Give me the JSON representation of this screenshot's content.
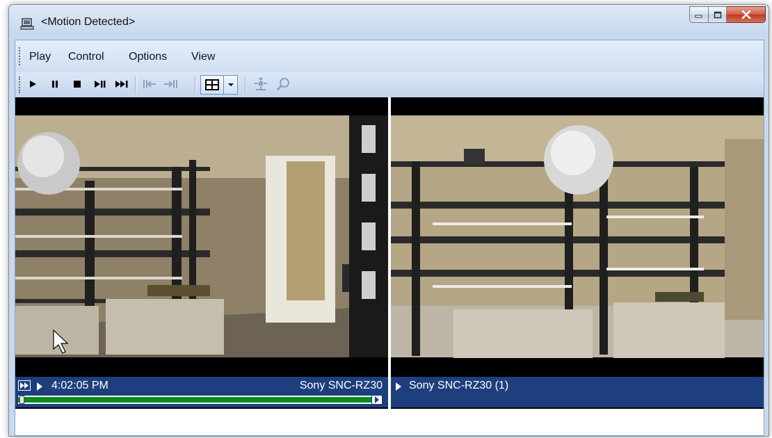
{
  "window": {
    "title": "<Motion Detected>",
    "app_icon": "computer-monitor-icon"
  },
  "caption_buttons": [
    "minimize-icon",
    "maximize-icon",
    "close-icon"
  ],
  "menu": {
    "items": [
      {
        "label": "Play"
      },
      {
        "label": "Control"
      },
      {
        "label": "Options"
      },
      {
        "label": "View"
      }
    ]
  },
  "toolbar": {
    "buttons": [
      "play-icon",
      "pause-icon",
      "stop-icon",
      "step-frame-icon",
      "skip-end-icon",
      "seek-back-icon",
      "seek-forward-icon",
      "layout-grid-icon",
      "dropdown-arrow-icon",
      "ptz-icon",
      "zoom-icon"
    ]
  },
  "panes": [
    {
      "status_time": "4:02:05 PM",
      "camera_name": "Sony SNC-RZ30",
      "progress": 0.02
    },
    {
      "camera_name": "Sony SNC-RZ30 (1)"
    }
  ],
  "colors": {
    "status_bar": "#1e3f7e",
    "progress": "#0a8c1c",
    "close_button": "#c9442a"
  }
}
